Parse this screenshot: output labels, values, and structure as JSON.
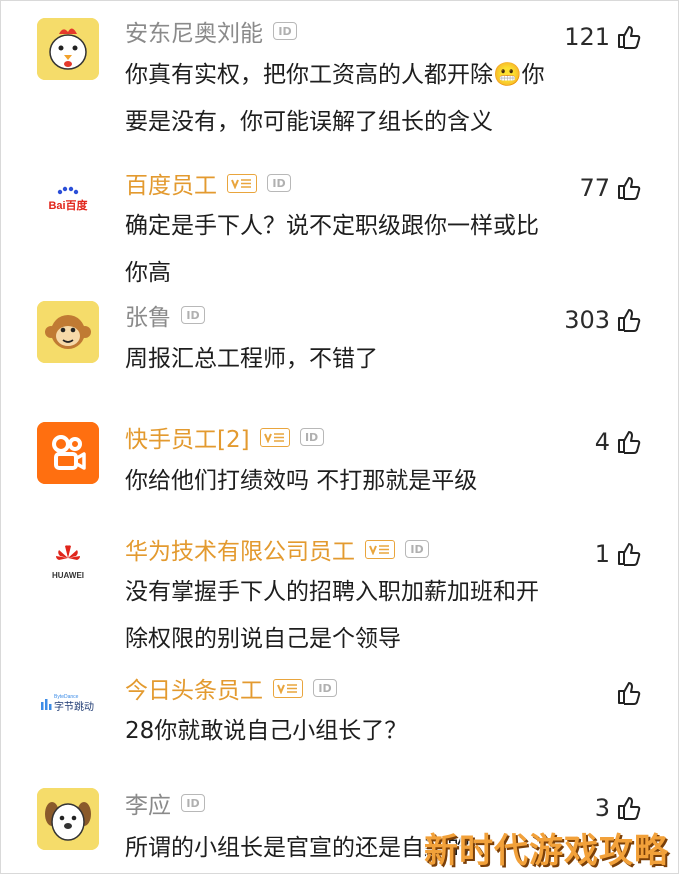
{
  "comments": [
    {
      "username": "安东尼奥刘能",
      "official": false,
      "likes": "121",
      "lines": [
        "你真有实权，把你工资高的人都开除😬你",
        "要是没有，你可能误解了组长的含义"
      ],
      "avatar": "chicken-avatar"
    },
    {
      "username": "百度员工",
      "official": true,
      "likes": "77",
      "lines": [
        "确定是手下人？说不定职级跟你一样或比",
        "你高"
      ],
      "avatar": "baidu-logo",
      "logo_text": "Bai百度"
    },
    {
      "username": "张鲁",
      "official": false,
      "likes": "303",
      "lines": [
        "周报汇总工程师，不错了"
      ],
      "avatar": "monkey-avatar"
    },
    {
      "username": "快手员工[2]",
      "official": true,
      "likes": "4",
      "lines": [
        "你给他们打绩效吗 不打那就是平级"
      ],
      "avatar": "kuaishou-logo"
    },
    {
      "username": "华为技术有限公司员工",
      "official": true,
      "likes": "1",
      "lines": [
        "没有掌握手下人的招聘入职加薪加班和开",
        "除权限的别说自己是个领导"
      ],
      "avatar": "huawei-logo",
      "logo_text": "HUAWEI"
    },
    {
      "username": "今日头条员工",
      "official": true,
      "likes": "",
      "lines": [
        "28你就敢说自己小组长了？"
      ],
      "avatar": "bytedance-logo",
      "logo_text": "字节跳动",
      "logo_subtext": "ByteDance"
    },
    {
      "username": "李应",
      "official": false,
      "likes": "3",
      "lines": [
        "所谓的小组长是官宣的还是自封的"
      ],
      "avatar": "dog-avatar"
    }
  ],
  "badges": {
    "id_label": "ID"
  },
  "watermark": "新时代游戏攻略",
  "colors": {
    "official_name": "#e39a2f",
    "normal_name": "#8a8a8a",
    "text": "#1e1e1e"
  }
}
